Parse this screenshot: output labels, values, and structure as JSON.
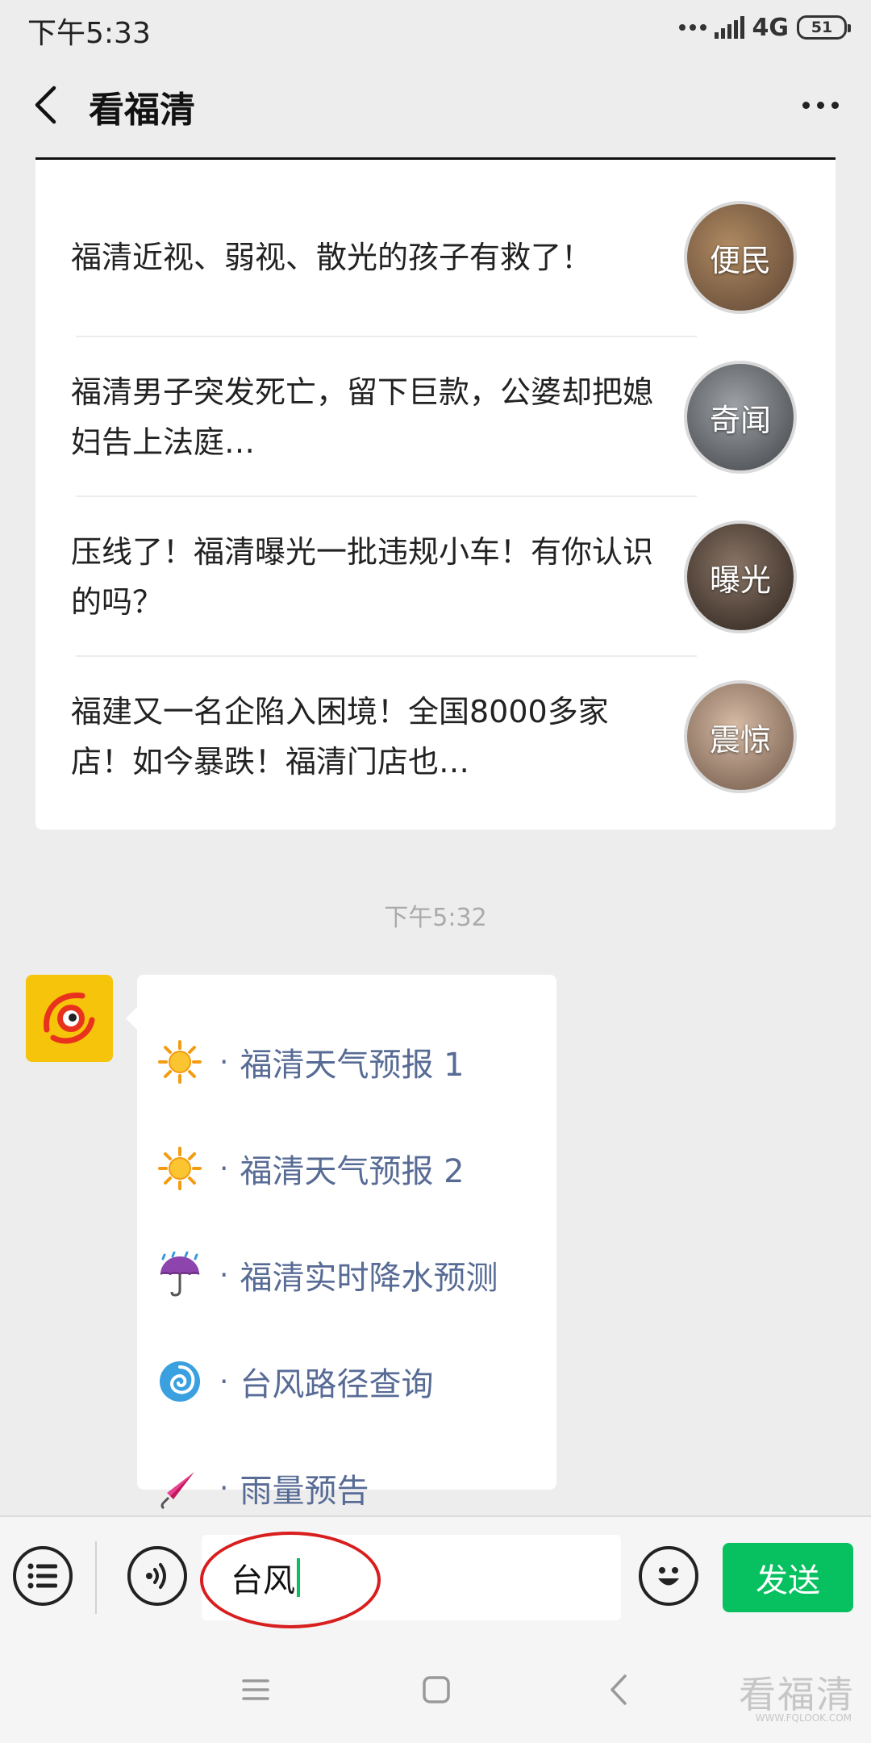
{
  "status_bar": {
    "time": "下午5:33",
    "network": "4G",
    "battery": "51"
  },
  "nav": {
    "title": "看福清"
  },
  "articles": [
    {
      "title": "福清近视、弱视、散光的孩子有救了！",
      "thumb_label": "便民",
      "thumb_color": "#8a6a4a"
    },
    {
      "title": "福清男子突发死亡，留下巨款，公婆却把媳妇告上法庭…",
      "thumb_label": "奇闻",
      "thumb_color": "#6b6e72"
    },
    {
      "title": "压线了！福清曝光一批违规小车！有你认识的吗？",
      "thumb_label": "曝光",
      "thumb_color": "#5a4a3e"
    },
    {
      "title": "福建又一名企陷入困境！全国8000多家店！如今暴跌！福清门店也…",
      "thumb_label": "震惊",
      "thumb_color": "#a08775"
    }
  ],
  "timestamp": "下午5:32",
  "menu": {
    "separator": "·",
    "items": [
      {
        "icon": "sun-icon",
        "label": "福清天气预报 1"
      },
      {
        "icon": "sun-icon",
        "label": "福清天气预报 2"
      },
      {
        "icon": "umbrella-rain-icon",
        "label": "福清实时降水预测"
      },
      {
        "icon": "cyclone-icon",
        "label": "台风路径查询"
      },
      {
        "icon": "closed-umbrella-icon",
        "label": "雨量预告"
      }
    ]
  },
  "input": {
    "value": "台风",
    "send_label": "发送"
  },
  "colors": {
    "send_green": "#07c160",
    "link_blue": "#576b95",
    "highlight_red": "#d81e1e"
  },
  "watermark": {
    "text": "看福清",
    "url": "WWW.FQLOOK.COM"
  }
}
